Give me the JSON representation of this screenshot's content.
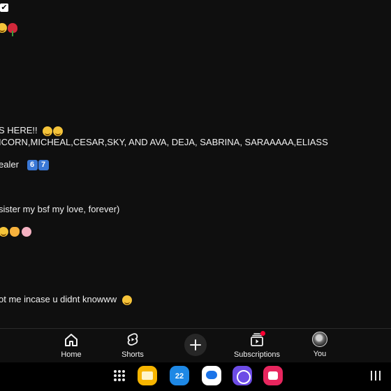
{
  "status": {
    "checkbox_icon": "checkbox-checked-icon"
  },
  "bio": {
    "emoji_row": [
      "smile-emoji",
      "rose-emoji"
    ],
    "lines": {
      "l1": "S HERE!!",
      "l2": "ICORN,MICHEAL,CESAR,SKY, AND AVA, DEJA, SABRINA, SARAAAAA,ELIASS",
      "l3": "ealer",
      "l3_keycaps": [
        "6",
        "7"
      ],
      "l4": "sister my bsf my  love, forever)",
      "l6": "ot me incase u didnt knowww"
    }
  },
  "bottom_nav": {
    "items": [
      {
        "label": "Home",
        "icon": "home-icon"
      },
      {
        "label": "Shorts",
        "icon": "shorts-icon"
      },
      {
        "label": "",
        "icon": "create-plus-icon"
      },
      {
        "label": "Subscriptions",
        "icon": "subscriptions-icon"
      },
      {
        "label": "You",
        "icon": "avatar"
      }
    ]
  },
  "taskbar": {
    "apps": [
      "apps-grid-icon",
      "my-files-app",
      "calendar-app",
      "messages-app",
      "internet-app",
      "screen-recorder-app",
      "recents-icon"
    ],
    "calendar_day": "22"
  },
  "colors": {
    "background": "#0f0f0f",
    "accent_red": "#ff0033",
    "text": "#f1f1f1"
  }
}
